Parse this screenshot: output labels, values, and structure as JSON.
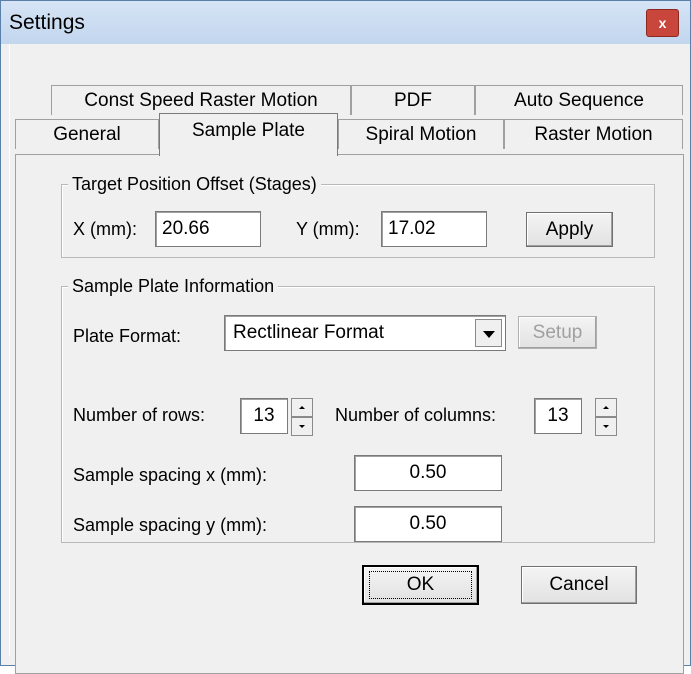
{
  "window": {
    "title": "Settings",
    "close_glyph": "x"
  },
  "tabs_row1": [
    {
      "label": "Const Speed Raster Motion"
    },
    {
      "label": "PDF"
    },
    {
      "label": "Auto Sequence"
    }
  ],
  "tabs_row2": [
    {
      "label": "General"
    },
    {
      "label": "Sample Plate",
      "active": true
    },
    {
      "label": "Spiral Motion"
    },
    {
      "label": "Raster Motion"
    }
  ],
  "target_offset": {
    "legend": "Target Position Offset (Stages)",
    "x_label": "X (mm):",
    "x_value": "20.66",
    "y_label": "Y (mm):",
    "y_value": "17.02",
    "apply_label": "Apply"
  },
  "plate_info": {
    "legend": "Sample Plate Information",
    "format_label": "Plate Format:",
    "format_value": "Rectlinear Format",
    "setup_label": "Setup",
    "rows_label": "Number of rows:",
    "rows_value": "13",
    "cols_label": "Number of columns:",
    "cols_value": "13",
    "spacing_x_label": "Sample spacing x (mm):",
    "spacing_x_value": "0.50",
    "spacing_y_label": "Sample spacing y (mm):",
    "spacing_y_value": "0.50"
  },
  "buttons": {
    "ok_label": "OK",
    "cancel_label": "Cancel"
  },
  "colors": {
    "title_bar": "#c2d6ee",
    "close_button": "#c9463c",
    "dialog_bg": "#f0f0f0"
  },
  "icons": {
    "close": "close-icon",
    "dropdown": "chevron-down-icon",
    "spin_up": "arrow-up-icon",
    "spin_down": "arrow-down-icon"
  }
}
